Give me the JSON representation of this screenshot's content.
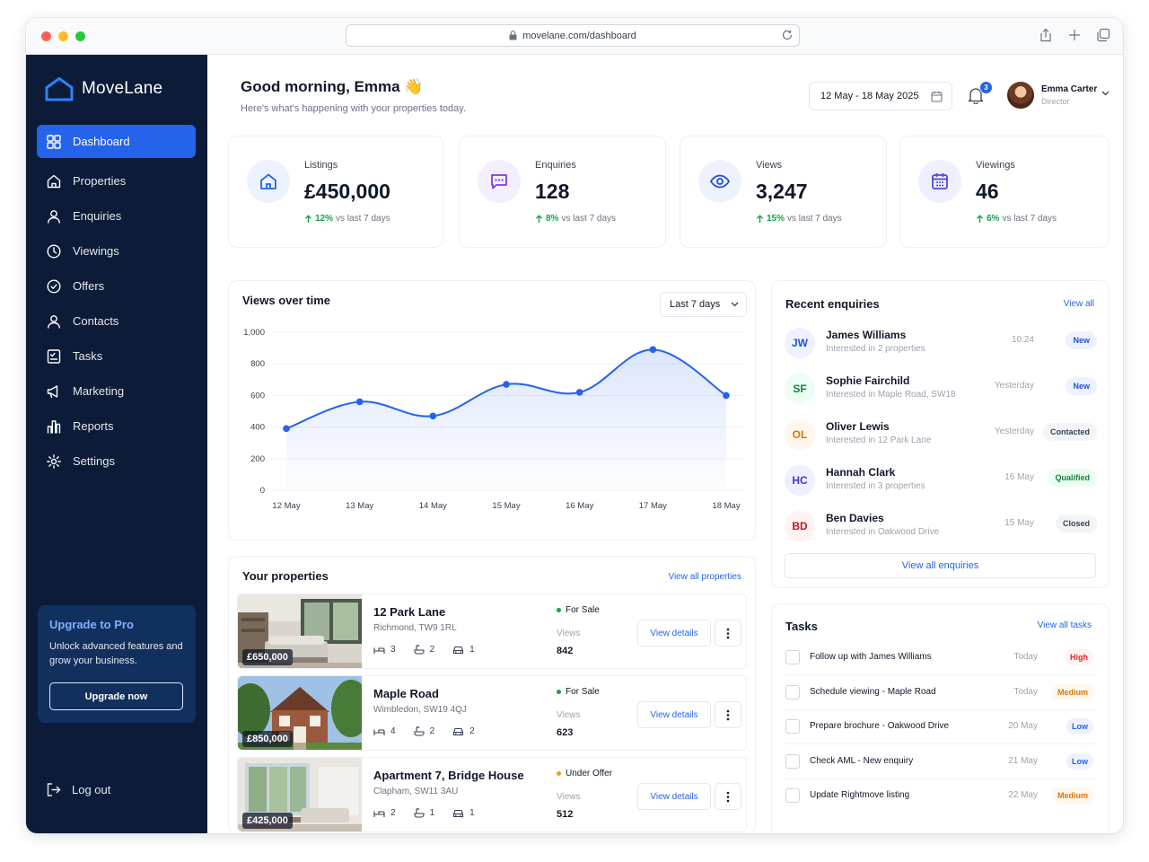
{
  "browser": {
    "url": "movelane.com/dashboard"
  },
  "brand": {
    "name": "MoveLane"
  },
  "sidebar": {
    "items": [
      {
        "label": "Dashboard",
        "icon": "grid-icon"
      },
      {
        "label": "Properties",
        "icon": "home-icon"
      },
      {
        "label": "Enquiries",
        "icon": "user-icon"
      },
      {
        "label": "Viewings",
        "icon": "clock-icon"
      },
      {
        "label": "Offers",
        "icon": "tag-icon"
      },
      {
        "label": "Contacts",
        "icon": "contact-icon"
      },
      {
        "label": "Tasks",
        "icon": "checklist-icon"
      },
      {
        "label": "Marketing",
        "icon": "megaphone-icon"
      },
      {
        "label": "Reports",
        "icon": "bar-chart-icon"
      },
      {
        "label": "Settings",
        "icon": "gear-icon"
      }
    ],
    "upgrade": {
      "title": "Upgrade to Pro",
      "text": "Unlock advanced features and grow your business.",
      "button": "Upgrade now"
    },
    "logout": "Log out"
  },
  "header": {
    "greeting": "Good morning, Emma 👋",
    "subtitle": "Here's what's happening with your properties today.",
    "date_range": "12 May - 18 May 2025",
    "notifications": "3",
    "user_name": "Emma Carter",
    "user_role": "Director"
  },
  "stats": [
    {
      "label": "Listings",
      "value": "£450,000",
      "pct": "12%",
      "note": "vs last 7 days",
      "icon": "house-icon",
      "color": "#2563eb",
      "bg": "#eef2ff"
    },
    {
      "label": "Enquiries",
      "value": "128",
      "pct": "8%",
      "note": "vs last 7 days",
      "icon": "chat-icon",
      "color": "#7c3aed",
      "bg": "#f3efff"
    },
    {
      "label": "Views",
      "value": "3,247",
      "pct": "15%",
      "note": "vs last 7 days",
      "icon": "eye-icon",
      "color": "#1d4ed8",
      "bg": "#eef2ff"
    },
    {
      "label": "Viewings",
      "value": "46",
      "pct": "6%",
      "note": "vs last 7 days",
      "icon": "calendar-icon",
      "color": "#4f46e5",
      "bg": "#eef0ff"
    }
  ],
  "views_chart": {
    "title": "Views over time",
    "range": "Last 7 days"
  },
  "chart_data": {
    "type": "area",
    "categories": [
      "12 May",
      "13 May",
      "14 May",
      "15 May",
      "16 May",
      "17 May",
      "18 May"
    ],
    "values": [
      390,
      560,
      470,
      670,
      620,
      890,
      600
    ],
    "yticks": [
      "1,000",
      "800",
      "600",
      "400",
      "200",
      "0"
    ],
    "ylim": [
      0,
      1000
    ],
    "grid": true,
    "color": "#2563eb"
  },
  "properties": {
    "title": "Your properties",
    "link": "View all properties",
    "views_label": "Views",
    "button": "View details",
    "items": [
      {
        "name": "12 Park Lane",
        "address": "Richmond, TW9 1RL",
        "price": "£650,000",
        "beds": "3",
        "baths": "2",
        "parking": "1",
        "status": "For Sale",
        "status_color": "#16a34a",
        "views": "842"
      },
      {
        "name": "Maple Road",
        "address": "Wimbledon, SW19 4QJ",
        "price": "£850,000",
        "beds": "4",
        "baths": "2",
        "parking": "2",
        "status": "For Sale",
        "status_color": "#16a34a",
        "views": "623"
      },
      {
        "name": "Apartment 7, Bridge House",
        "address": "Clapham, SW11 3AU",
        "price": "£425,000",
        "beds": "2",
        "baths": "1",
        "parking": "1",
        "status": "Under Offer",
        "status_color": "#f59e0b",
        "views": "512"
      }
    ]
  },
  "enquiries": {
    "title": "Recent enquiries",
    "link": "View all",
    "button": "View all enquiries",
    "items": [
      {
        "initials": "JW",
        "name": "James Williams",
        "desc": "Interested in 2 properties",
        "time": "10:24",
        "status": "New",
        "fg": "#1d4ed8",
        "bg": "#eef2ff",
        "badge_fg": "#1d4ed8",
        "badge_bg": "#eef2ff"
      },
      {
        "initials": "SF",
        "name": "Sophie Fairchild",
        "desc": "Interested in Maple Road, SW18",
        "time": "Yesterday",
        "status": "New",
        "fg": "#15803d",
        "bg": "#ecfdf3",
        "badge_fg": "#1d4ed8",
        "badge_bg": "#eef2ff"
      },
      {
        "initials": "OL",
        "name": "Oliver Lewis",
        "desc": "Interested in 12 Park Lane",
        "time": "Yesterday",
        "status": "Contacted",
        "fg": "#d97706",
        "bg": "#fff7ed",
        "badge_fg": "#374151",
        "badge_bg": "#f3f4f6"
      },
      {
        "initials": "HC",
        "name": "Hannah Clark",
        "desc": "Interested in 3 properties",
        "time": "16 May",
        "status": "Qualified",
        "fg": "#4338ca",
        "bg": "#eef0ff",
        "badge_fg": "#15803d",
        "badge_bg": "#ecfdf3"
      },
      {
        "initials": "BD",
        "name": "Ben Davies",
        "desc": "Interested in Oakwood Drive",
        "time": "15 May",
        "status": "Closed",
        "fg": "#b91c1c",
        "bg": "#fef2f2",
        "badge_fg": "#374151",
        "badge_bg": "#f3f4f6"
      }
    ]
  },
  "tasks": {
    "title": "Tasks",
    "link": "View all tasks",
    "items": [
      {
        "label": "Follow up with James Williams",
        "due": "Today",
        "priority": "High",
        "fg": "#dc2626",
        "bg": "#fef2f2"
      },
      {
        "label": "Schedule viewing - Maple Road",
        "due": "Today",
        "priority": "Medium",
        "fg": "#d97706",
        "bg": "#fff7ed"
      },
      {
        "label": "Prepare brochure - Oakwood Drive",
        "due": "20 May",
        "priority": "Low",
        "fg": "#2563eb",
        "bg": "#eef2ff"
      },
      {
        "label": "Check AML - New enquiry",
        "due": "21 May",
        "priority": "Low",
        "fg": "#2563eb",
        "bg": "#eef2ff"
      },
      {
        "label": "Update Rightmove listing",
        "due": "22 May",
        "priority": "Medium",
        "fg": "#d97706",
        "bg": "#fff7ed"
      }
    ]
  }
}
